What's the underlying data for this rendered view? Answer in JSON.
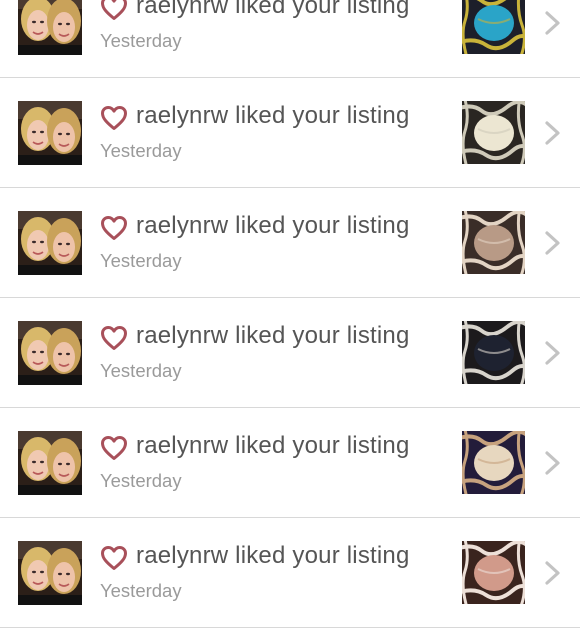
{
  "notifications": [
    {
      "username": "raelynrw",
      "action": "liked your listing",
      "time": "Yesterday",
      "item_thumb": {
        "base": "#1d1f2a",
        "accent": "#2aa4c8",
        "stripe": "#c9b33a"
      }
    },
    {
      "username": "raelynrw",
      "action": "liked your listing",
      "time": "Yesterday",
      "item_thumb": {
        "base": "#2a2622",
        "accent": "#ece6d2",
        "stripe": "#cfcab9"
      }
    },
    {
      "username": "raelynrw",
      "action": "liked your listing",
      "time": "Yesterday",
      "item_thumb": {
        "base": "#3a2d28",
        "accent": "#b89a86",
        "stripe": "#e3d4c4"
      }
    },
    {
      "username": "raelynrw",
      "action": "liked your listing",
      "time": "Yesterday",
      "item_thumb": {
        "base": "#1c1a1c",
        "accent": "#1e2230",
        "stripe": "#d8d4cc"
      }
    },
    {
      "username": "raelynrw",
      "action": "liked your listing",
      "time": "Yesterday",
      "item_thumb": {
        "base": "#231c3a",
        "accent": "#e7d7bf",
        "stripe": "#c7a27e"
      }
    },
    {
      "username": "raelynrw",
      "action": "liked your listing",
      "time": "Yesterday",
      "item_thumb": {
        "base": "#3a241e",
        "accent": "#d19a8a",
        "stripe": "#ede0d8"
      }
    }
  ],
  "colors": {
    "heart": "#a8505a",
    "text": "#555555",
    "subtext": "#9a9a9a",
    "chevron": "#c3c3c3",
    "divider": "#d8d8d8"
  },
  "icons": {
    "heart": "heart-outline-icon",
    "chevron": "chevron-right-icon"
  }
}
